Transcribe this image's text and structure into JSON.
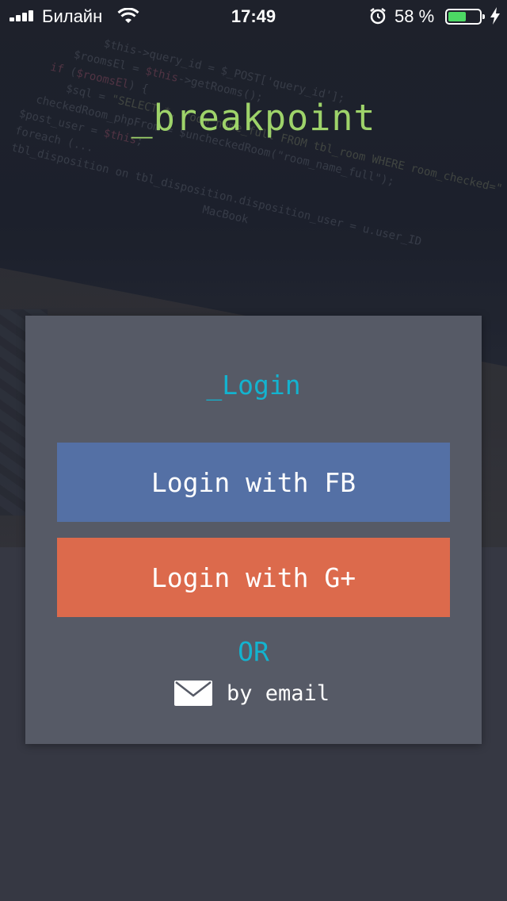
{
  "status_bar": {
    "carrier": "Билайн",
    "time": "17:49",
    "battery_percent": "58 %",
    "battery_level": 0.58,
    "icons": [
      "signal-icon",
      "wifi-icon",
      "alarm-icon",
      "battery-icon",
      "charging-icon"
    ]
  },
  "app": {
    "brand": "_breakpoint",
    "brand_color": "#9ed36a"
  },
  "login": {
    "title": "_Login",
    "fb_button_label": "Login with FB",
    "google_button_label": "Login with G+",
    "or_label": "OR",
    "email_label": "by email"
  },
  "colors": {
    "accent": "#13b3cf",
    "facebook": "#5470a5",
    "google": "#dc6a4c",
    "card": "#565a66",
    "page_background": "#363843"
  }
}
